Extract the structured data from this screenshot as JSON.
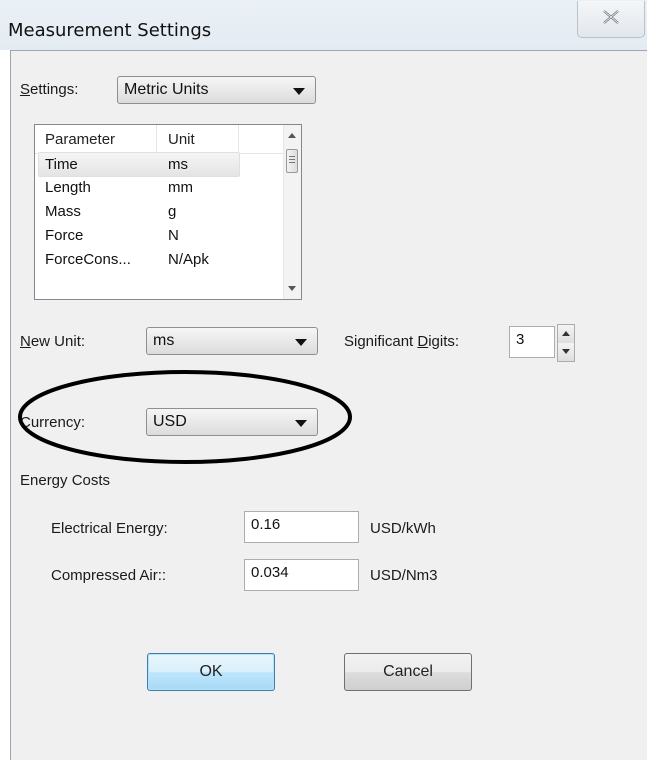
{
  "window": {
    "title": "Measurement Settings",
    "close_icon": "close-icon"
  },
  "settings": {
    "label_prefix": "S",
    "label_rest": "ettings:",
    "value": "Metric Units"
  },
  "table": {
    "columns": [
      "Parameter",
      "Unit"
    ],
    "rows": [
      {
        "parameter": "Time",
        "unit": "ms"
      },
      {
        "parameter": "Length",
        "unit": "mm"
      },
      {
        "parameter": "Mass",
        "unit": "g"
      },
      {
        "parameter": "Force",
        "unit": "N"
      },
      {
        "parameter": "ForceCons...",
        "unit": "N/Apk"
      }
    ],
    "selected_index": 0
  },
  "new_unit": {
    "label_prefix": "N",
    "label_rest": "ew Unit:",
    "value": "ms"
  },
  "significant_digits": {
    "label_pre": "Significant ",
    "label_u": "D",
    "label_post": "igits:",
    "value": "3"
  },
  "currency": {
    "label": "Currency:",
    "value": "USD",
    "highlight_color": "#000000"
  },
  "energy_costs": {
    "heading": "Energy Costs",
    "electrical": {
      "label": "Electrical Energy:",
      "value": "0.16",
      "unit": "USD/kWh"
    },
    "compressed_air": {
      "label": "Compressed Air::",
      "value": "0.034",
      "unit": "USD/Nm3"
    }
  },
  "buttons": {
    "ok": "OK",
    "cancel": "Cancel"
  }
}
